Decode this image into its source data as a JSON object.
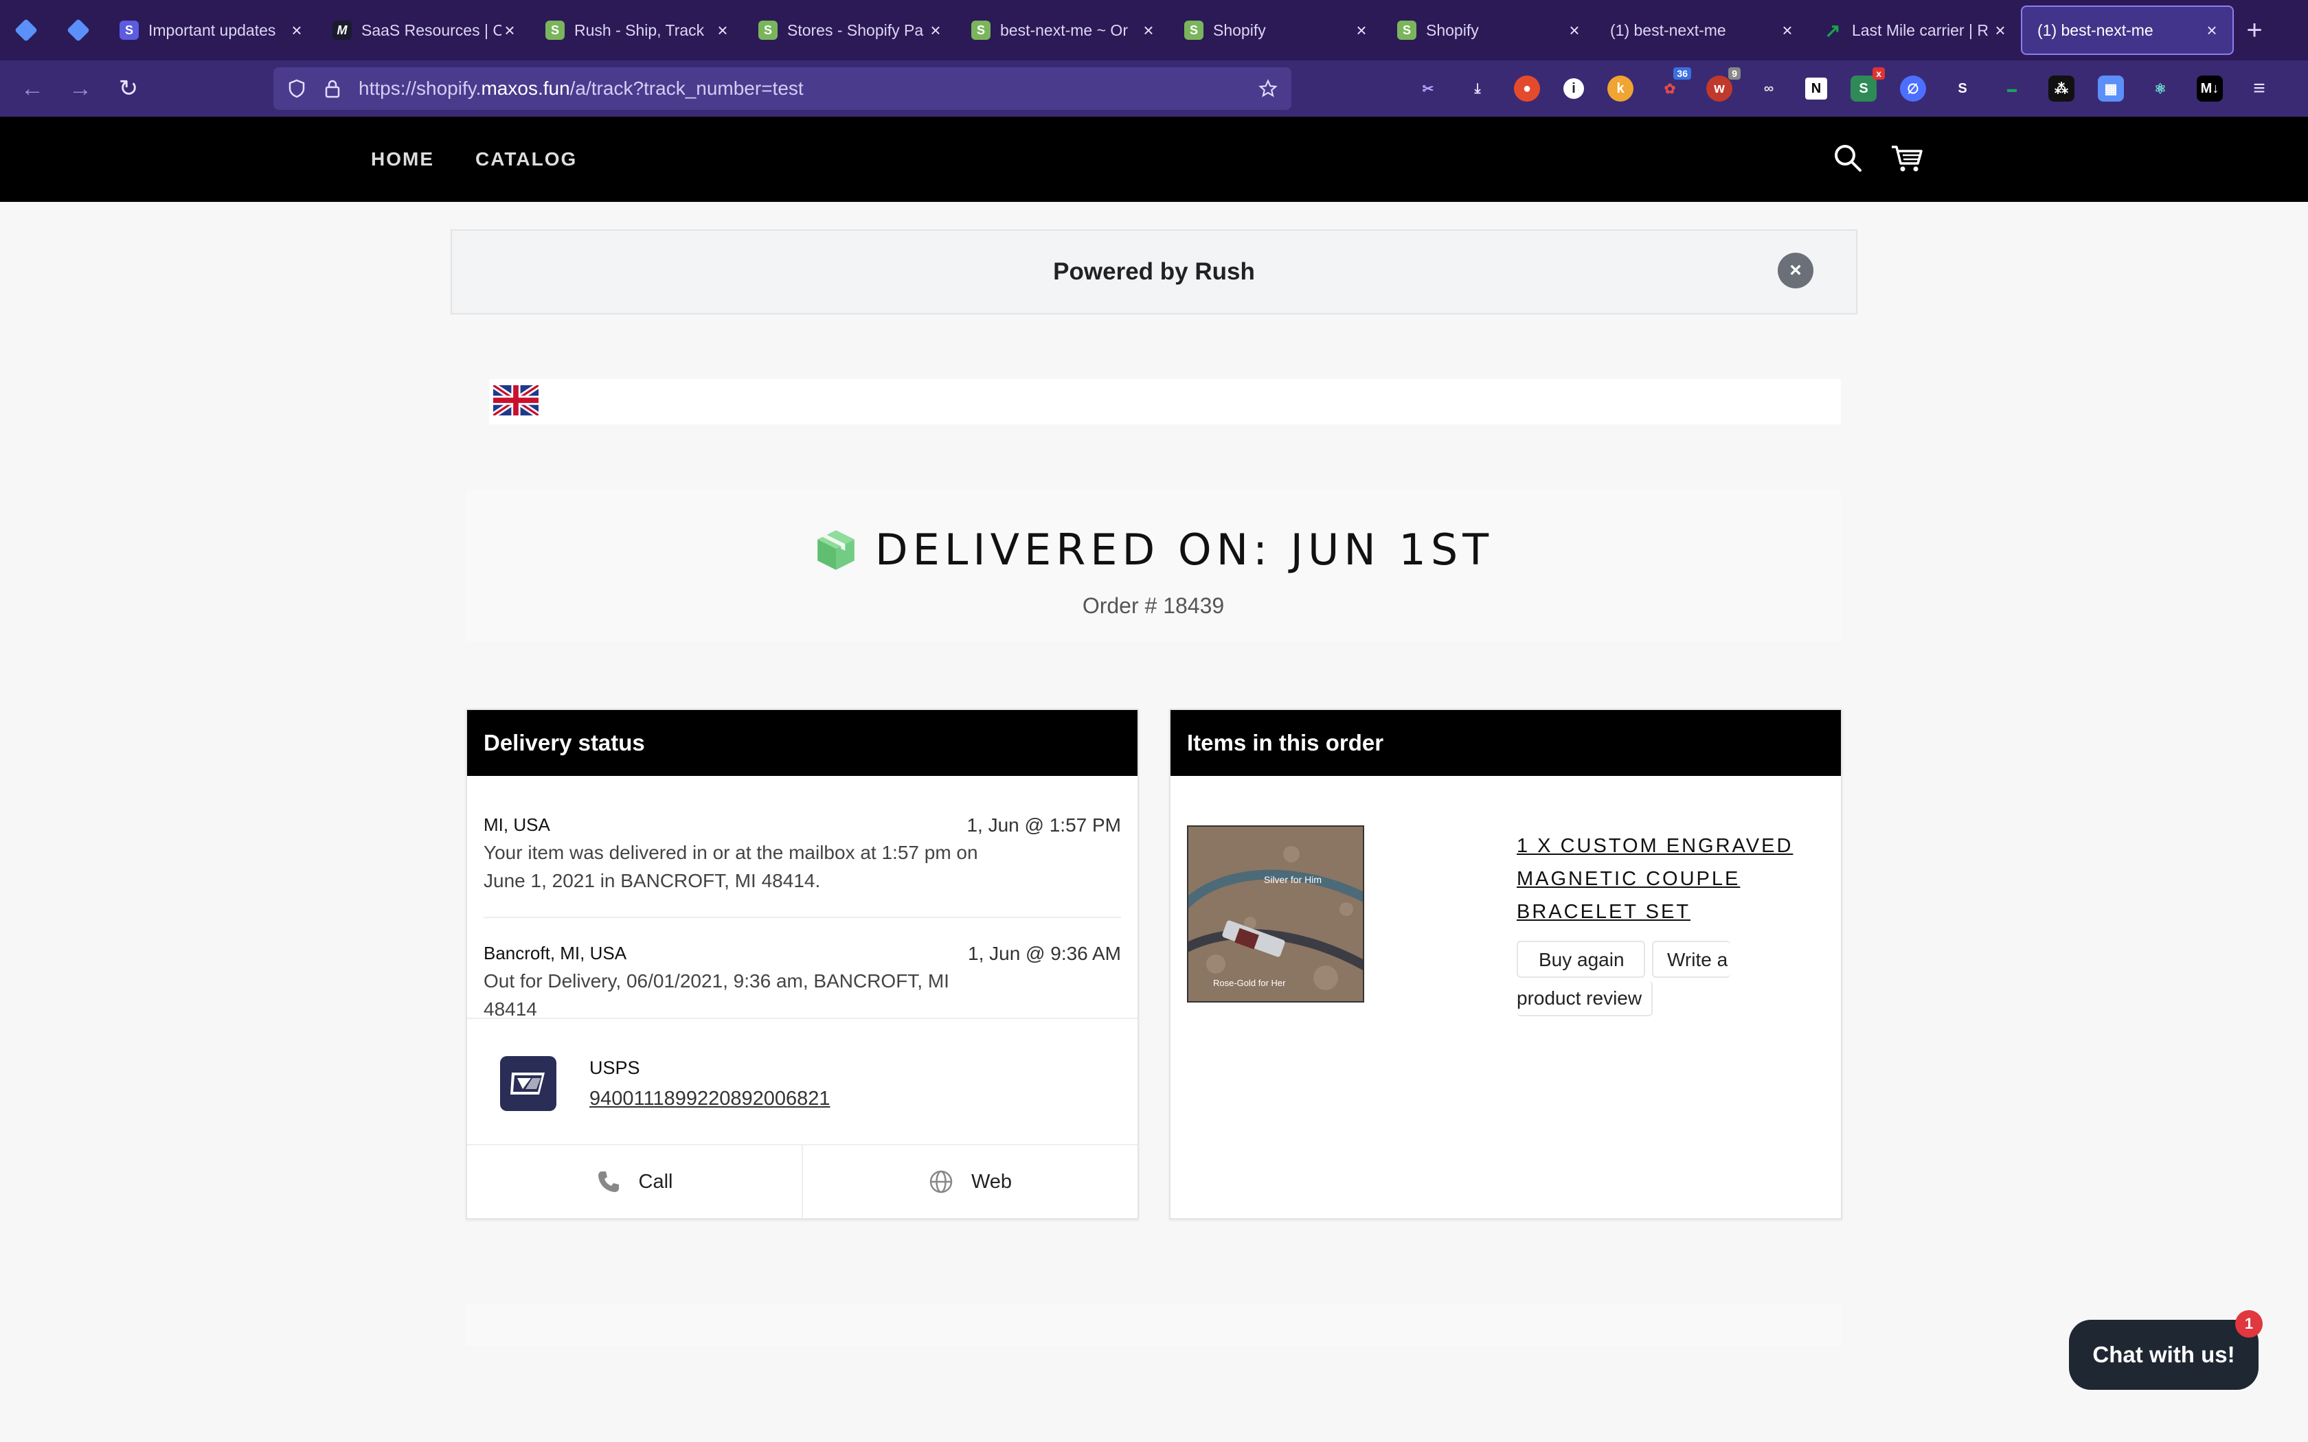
{
  "browser": {
    "tabs": [
      {
        "label": "Important updates",
        "favicon": "S",
        "color": "#5b5ce0"
      },
      {
        "label": "SaaS Resources | C",
        "favicon": "M",
        "color": "#1b1b2e"
      },
      {
        "label": "Rush - Ship, Track",
        "favicon": "S",
        "color": "#7ab55c"
      },
      {
        "label": "Stores - Shopify Pa",
        "favicon": "S",
        "color": "#7ab55c"
      },
      {
        "label": "best-next-me ~ Or",
        "favicon": "S",
        "color": "#7ab55c"
      },
      {
        "label": "Shopify",
        "favicon": "S",
        "color": "#7ab55c"
      },
      {
        "label": "Shopify",
        "favicon": "S",
        "color": "#7ab55c"
      },
      {
        "label": "(1) best-next-me",
        "favicon": "",
        "color": ""
      },
      {
        "label": "Last Mile carrier | R",
        "favicon": "↗",
        "color": "#17a34a"
      }
    ],
    "active_tab": {
      "label": "(1) best-next-me"
    },
    "url_prefix": "https://shopify.",
    "url_host": "maxos.fun",
    "url_suffix": "/a/track?track_number=test",
    "new_tab_symbol": "+"
  },
  "site": {
    "nav": {
      "home": "HOME",
      "catalog": "CATALOG"
    }
  },
  "banner": {
    "text": "Powered by Rush",
    "close_symbol": "×"
  },
  "language": {
    "flag": "uk-flag-icon"
  },
  "tracking": {
    "title": "DELIVERED ON: JUN 1ST",
    "order_number": "Order # 18439",
    "status_color": "#6cc47c"
  },
  "delivery_status": {
    "heading": "Delivery status",
    "events": [
      {
        "location": "MI, USA",
        "time": "1, Jun @ 1:57 PM",
        "description": "Your item was delivered in or at the mailbox at 1:57 pm on June 1, 2021 in BANCROFT, MI 48414."
      },
      {
        "location": "Bancroft, MI, USA",
        "time": "1, Jun @ 9:36 AM",
        "description": "Out for Delivery, 06/01/2021, 9:36 am, BANCROFT, MI 48414"
      }
    ],
    "carrier": {
      "name": "USPS",
      "tracking_number": "9400111899220892006821"
    },
    "actions": {
      "call": "Call",
      "web": "Web"
    }
  },
  "items": {
    "heading": "Items in this order",
    "product": {
      "title": "1 X CUSTOM ENGRAVED MAGNETIC COUPLE BRACELET SET",
      "image_caption_top": "Silver for Him",
      "image_caption_bottom": "Rose-Gold for Her"
    },
    "buttons": {
      "buy_again": "Buy again",
      "review_line1": "Write a",
      "review_line2": "product review"
    }
  },
  "chat": {
    "label": "Chat with us!",
    "badge": "1"
  }
}
